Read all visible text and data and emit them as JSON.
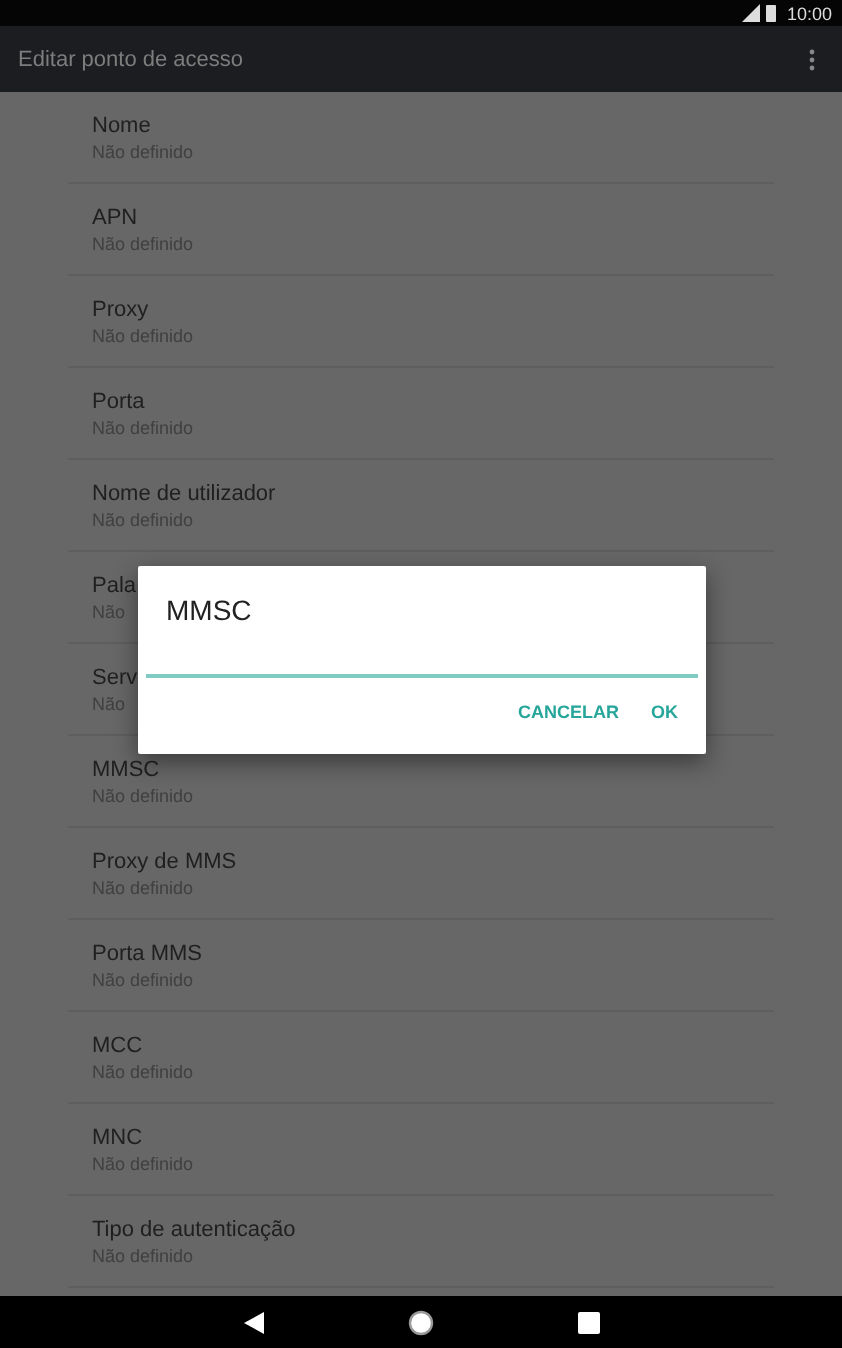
{
  "status_bar": {
    "time": "10:00"
  },
  "app_bar": {
    "title": "Editar ponto de acesso"
  },
  "settings": [
    {
      "label": "Nome",
      "value": "Não definido"
    },
    {
      "label": "APN",
      "value": "Não definido"
    },
    {
      "label": "Proxy",
      "value": "Não definido"
    },
    {
      "label": "Porta",
      "value": "Não definido"
    },
    {
      "label": "Nome de utilizador",
      "value": "Não definido"
    },
    {
      "label": "Pala",
      "value": "Não"
    },
    {
      "label": "Serv",
      "value": "Não"
    },
    {
      "label": "MMSC",
      "value": "Não definido"
    },
    {
      "label": "Proxy de MMS",
      "value": "Não definido"
    },
    {
      "label": "Porta MMS",
      "value": "Não definido"
    },
    {
      "label": "MCC",
      "value": "Não definido"
    },
    {
      "label": "MNC",
      "value": "Não definido"
    },
    {
      "label": "Tipo de autenticação",
      "value": "Não definido"
    }
  ],
  "dialog": {
    "title": "MMSC",
    "buttons": [
      "CANCELAR",
      "OK"
    ]
  }
}
